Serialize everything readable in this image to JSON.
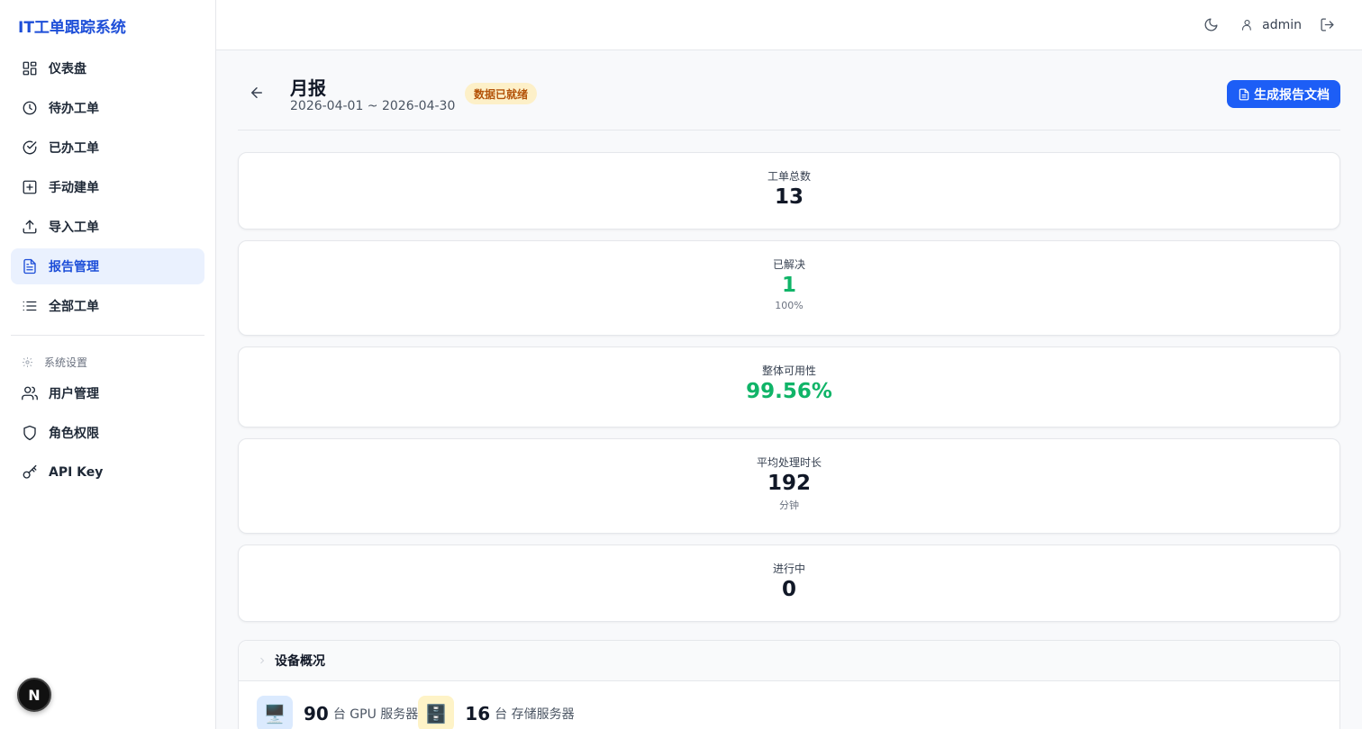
{
  "app": {
    "title": "IT工单跟踪系统"
  },
  "sidebar": {
    "items": [
      {
        "label": "仪表盘",
        "icon": "dashboard-icon"
      },
      {
        "label": "待办工单",
        "icon": "clock-icon"
      },
      {
        "label": "已办工单",
        "icon": "check-circle-icon"
      },
      {
        "label": "手动建单",
        "icon": "plus-square-icon"
      },
      {
        "label": "导入工单",
        "icon": "upload-icon"
      },
      {
        "label": "报告管理",
        "icon": "file-text-icon",
        "active": true
      },
      {
        "label": "全部工单",
        "icon": "list-icon"
      }
    ],
    "section_label": "系统设置",
    "settings_items": [
      {
        "label": "用户管理",
        "icon": "users-icon"
      },
      {
        "label": "角色权限",
        "icon": "shield-icon"
      },
      {
        "label": "API Key",
        "icon": "key-icon"
      }
    ],
    "badge": "N"
  },
  "topbar": {
    "username": "admin"
  },
  "page": {
    "title": "月报",
    "range": "2026-04-01 ~ 2026-04-30",
    "status": "数据已就绪",
    "generate_button": "生成报告文档"
  },
  "stats": [
    {
      "label": "工单总数",
      "value": "13",
      "sub": ""
    },
    {
      "label": "已解决",
      "value": "1",
      "sub": "100%"
    },
    {
      "label": "整体可用性",
      "value": "99.56%",
      "sub": ""
    },
    {
      "label": "平均处理时长",
      "value": "192",
      "sub": "分钟"
    },
    {
      "label": "进行中",
      "value": "0",
      "sub": ""
    }
  ],
  "devices": {
    "title": "设备概况",
    "items": [
      {
        "count": "90",
        "unit": "台 GPU 服务器",
        "icon": "monitor-icon"
      },
      {
        "count": "16",
        "unit": "台 存储服务器",
        "icon": "file-cabinet-icon"
      }
    ]
  },
  "colors": {
    "accent": "#1d5ef6",
    "success": "#10b468",
    "warning_bg": "#fdf0c8"
  }
}
